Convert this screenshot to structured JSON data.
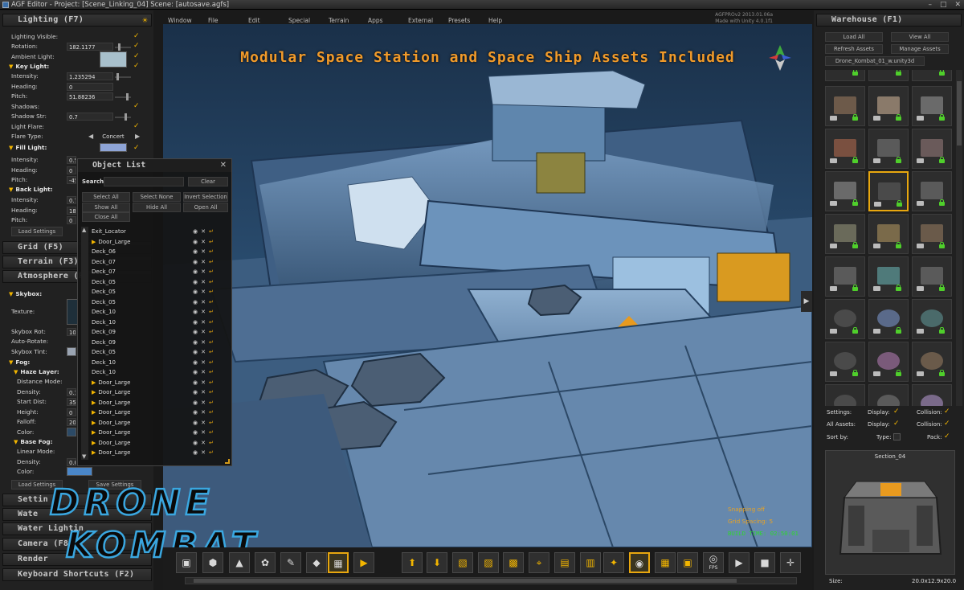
{
  "window": {
    "title": "AGF Editor - Project: [Scene_Linking_04] Scene: [autosave.agfs]"
  },
  "menu": [
    "Window",
    "File",
    "Edit",
    "Special",
    "Terrain",
    "Apps",
    "External",
    "Presets",
    "Help"
  ],
  "version": {
    "line1": "AGFPROv2 2013.01.06a",
    "line2": "Made with Unity 4.0.1f1"
  },
  "lighting": {
    "header": "Lighting (F7)",
    "lighting_visible": "Lighting Visible:",
    "rotation_label": "Rotation:",
    "rotation_value": "182.1177",
    "ambient_light": "Ambient Light:",
    "key_light": "Key Light:",
    "key": {
      "intensity_label": "Intensity:",
      "intensity_value": "1.235294",
      "heading_label": "Heading:",
      "heading_value": "0",
      "pitch_label": "Pitch:",
      "pitch_value": "51.88236"
    },
    "shadows": "Shadows:",
    "shadow_str_label": "Shadow Str:",
    "shadow_str_value": "0.7",
    "light_flare": "Light Flare:",
    "flare_type_label": "Flare Type:",
    "flare_type_value": "Concert",
    "fill_light": "Fill Light:",
    "fill": {
      "intensity_label": "Intensity:",
      "intensity_value": "0.5",
      "heading_label": "Heading:",
      "heading_value": "0",
      "pitch_label": "Pitch:",
      "pitch_value": "-45"
    },
    "back_light": "Back Light:",
    "back": {
      "intensity_label": "Intensity:",
      "intensity_value": "0.71",
      "heading_label": "Heading:",
      "heading_value": "180",
      "pitch_label": "Pitch:",
      "pitch_value": "0"
    },
    "load_settings": "Load Settings",
    "colors": {
      "ambient": "#a8c0cc",
      "fill": "#8ea4d6",
      "accent": "#f2b500"
    }
  },
  "sections": {
    "grid": "Grid (F5)",
    "terrain": "Terrain (F3)",
    "atmosphere": "Atmosphere (F",
    "settings": "Settin",
    "water": "Wate",
    "water_lighting": "Water Lightin",
    "camera": "Camera (F8)",
    "render": "Render",
    "keyboard": "Keyboard Shortcuts (F2)"
  },
  "atmosphere": {
    "skybox": "Skybox:",
    "texture": "Texture:",
    "skybox_rot_label": "Skybox Rot:",
    "skybox_rot_value": "104",
    "auto_rotate": "Auto-Rotate:",
    "skybox_tint": "Skybox Tint:",
    "fog": "Fog:",
    "haze_layer": "Haze Layer:",
    "distance_mode": "Distance Mode:",
    "density_label": "Density:",
    "density_value": "0.18",
    "start_dist_label": "Start Dist:",
    "start_dist_value": "353",
    "height_label": "Height:",
    "height_value": "0",
    "falloff_label": "Falloff:",
    "falloff_value": "200",
    "color_label": "Color:",
    "base_fog": "Base Fog:",
    "linear_mode": "Linear Mode:",
    "base_density_label": "Density:",
    "base_density_value": "0.00",
    "base_color_label": "Color:",
    "load_settings": "Load Settings",
    "save_settings": "Save Settings"
  },
  "viewport": {
    "banner": "Modular Space Station and Space Ship Assets Included",
    "status": {
      "snapping": "Snapping off",
      "grid_spacing": "Grid Spacing: 5",
      "build_time": "BUILD TIME: 02:50:01"
    }
  },
  "object_list": {
    "title": "Object List",
    "search_label": "Search:",
    "clear": "Clear",
    "buttons": [
      "Select All",
      "Select None",
      "Invert Selection",
      "Show All",
      "Hide All",
      "Open All",
      "Close All"
    ],
    "items": [
      "Exit_Locator",
      "Door_Large",
      "Deck_06",
      "Deck_07",
      "Deck_07",
      "Deck_05",
      "Deck_05",
      "Deck_05",
      "Deck_10",
      "Deck_10",
      "Deck_09",
      "Deck_09",
      "Deck_05",
      "Deck_10",
      "Deck_10",
      "Door_Large",
      "Door_Large",
      "Door_Large",
      "Door_Large",
      "Door_Large",
      "Door_Large",
      "Door_Large",
      "Door_Large",
      "Door_Large"
    ],
    "folders": [
      false,
      true,
      false,
      false,
      false,
      false,
      false,
      false,
      false,
      false,
      false,
      false,
      false,
      false,
      false,
      true,
      true,
      true,
      true,
      true,
      true,
      true,
      true,
      true
    ]
  },
  "logo": {
    "line1": "DRONE",
    "line2": "KOMBAT"
  },
  "warehouse": {
    "header": "Warehouse (F1)",
    "load_all": "Load All",
    "view_all": "View All",
    "refresh_assets": "Refresh Assets",
    "manage_assets": "Manage Assets",
    "file": "Drone_Kombat_01_w.unity3d",
    "settings_label": "Settings:",
    "display_label": "Display:",
    "collision_label": "Collision:",
    "all_assets_label": "All Assets:",
    "sort_by_label": "Sort by:",
    "type_label": "Type:",
    "pack_label": "Pack:",
    "preview_title": "Section_04",
    "size_label": "Size:",
    "size_value": "20.0x12.9x20.0"
  },
  "toolbar": {
    "icons": [
      "save-icon",
      "cube-icon",
      "terrain-icon",
      "flower-icon",
      "paint-brush-icon",
      "box-icon",
      "grid-icon",
      "play-icon",
      "arrow-up-icon",
      "arrow-down-icon",
      "grid-snap-icon",
      "grid-snap-2-icon",
      "grid-snap-3-icon",
      "crosshair-icon",
      "grid-snap-4-icon",
      "grid-snap-5-icon",
      "grid-snap-6-icon",
      "eye-icon",
      "grid-snap-7-icon",
      "grid-snap-8-icon",
      "fps-icon",
      "camera-fly-icon",
      "camera-icon",
      "move-gizmo-icon"
    ],
    "fps": "FPS"
  }
}
